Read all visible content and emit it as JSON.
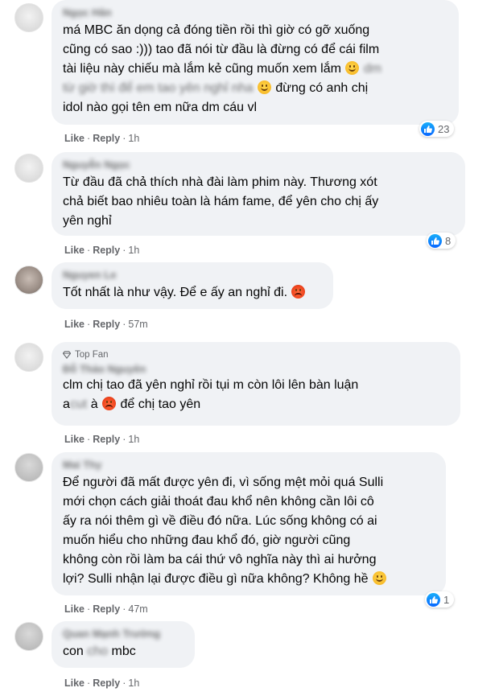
{
  "comments": [
    {
      "author": "Ngọc Hân",
      "text_a": "má MBC ăn dọng cả đóng tiền rồi thì giờ có gỡ xuống\ncũng có sao :))) tao đã nói từ đầu là đừng có để cái film\ntài liệu này chiếu mà lắm kẻ cũng muốn xem lắm ",
      "text_b": " dm\ntừ giờ thì để em tao yên nghỉ nha ",
      "text_c": " đừng có anh chị\nidol nào gọi tên em nữa dm cáu vl",
      "like": "Like",
      "reply": "Reply",
      "time": "1h",
      "reactions": "23"
    },
    {
      "author": "Nguyễn Ngọc",
      "text_a": "Từ đầu đã chả thích nhà đài làm phim này. Thương xót\nchả biết bao nhiêu toàn là hám fame, để yên cho chị ấy\nyên nghỉ",
      "like": "Like",
      "reply": "Reply",
      "time": "1h",
      "reactions": "8"
    },
    {
      "author": "Nguyen Le",
      "text_a": "Tốt nhất là như vậy. Để e ấy an nghỉ đi. ",
      "like": "Like",
      "reply": "Reply",
      "time": "57m"
    },
    {
      "badge": "Top Fan",
      "author": "Đỗ Thảo Nguyên",
      "text_a": "cl",
      "text_b": "m chị tao đã yên nghỉ rồi tụi m còn lôi lên bàn luận\n",
      "text_c": "a",
      "text_d": "cut",
      "text_e": " à ",
      "text_f": " để chị tao yên",
      "like": "Like",
      "reply": "Reply",
      "time": "1h"
    },
    {
      "author": "Mai Thy",
      "text_a": "Để người đã mất được yên đi, vì sống mệt mỏi quá Sulli\nmới chọn cách giải thoát đau khổ nên không cần lôi cô\nấy ra nói thêm gì về điều đó nữa. Lúc sống không có ai\nmuốn hiểu cho những đau khổ đó, giờ người cũng\nkhông còn rồi làm ba cái thứ vô nghĩa này thì ai hưởng\nlợi? Sulli nhận lại được điều gì nữa không? Không hề ",
      "like": "Like",
      "reply": "Reply",
      "time": "47m",
      "reactions": "1"
    },
    {
      "author": "Quan Mạnh Trường",
      "text_a": "con ",
      "text_b": "cho",
      "text_c": " mbc",
      "like": "Like",
      "reply": "Reply",
      "time": "1h"
    }
  ],
  "colors": {
    "bubble": "#f0f2f5",
    "secondary_text": "#65676b",
    "like_blue": "#0866ff"
  },
  "icons": [
    "like-icon",
    "smile-emoji-icon",
    "angry-emoji-icon",
    "diamond-icon"
  ]
}
